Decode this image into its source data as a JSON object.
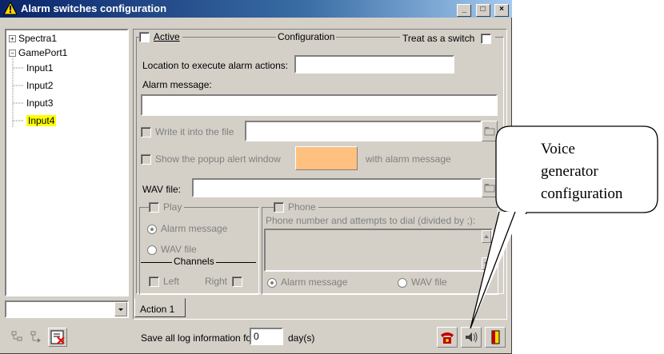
{
  "window": {
    "title": "Alarm switches configuration",
    "min_glyph": "_",
    "max_glyph": "□",
    "close_glyph": "×"
  },
  "tree": {
    "items": [
      {
        "label": "Spectra1",
        "expander": "+"
      },
      {
        "label": "GamePort1",
        "expander": "−"
      },
      {
        "label": "Input1"
      },
      {
        "label": "Input2"
      },
      {
        "label": "Input3"
      },
      {
        "label": "Input4",
        "selected": true
      }
    ]
  },
  "config": {
    "active_label": "Active",
    "group_title": "Configuration",
    "treat_switch_label": "Treat as a switch",
    "location_label": "Location to execute alarm actions:",
    "location_value": "",
    "alarm_message_label": "Alarm message:",
    "alarm_message_value": "",
    "write_file_label": "Write it into the file",
    "write_file_value": "",
    "popup_label": "Show the popup alert window",
    "popup_suffix": "with alarm message",
    "popup_color": "#ffc080",
    "wav_label": "WAV file:",
    "wav_value": "",
    "play_label": "Play",
    "play_alarm_message": "Alarm message",
    "play_wav_file": "WAV file",
    "channels_label": "Channels",
    "left_label": "Left",
    "right_label": "Right",
    "phone_label": "Phone",
    "phone_hint": "Phone number and attempts to dial (divided by ;):",
    "phone_value": "",
    "phone_alarm_message": "Alarm message",
    "phone_wav_file": "WAV file",
    "tab_action": "Action 1"
  },
  "footer": {
    "save_prefix": "Save all log information for",
    "days_value": "0",
    "days_suffix": "day(s)"
  },
  "callout": {
    "line1": "Voice",
    "line2": "generator",
    "line3": "configuration"
  },
  "colors": {
    "title_start": "#0a246a",
    "title_end": "#a6caf0",
    "face": "#d4d0c8",
    "selected_bg": "#ffff00"
  }
}
